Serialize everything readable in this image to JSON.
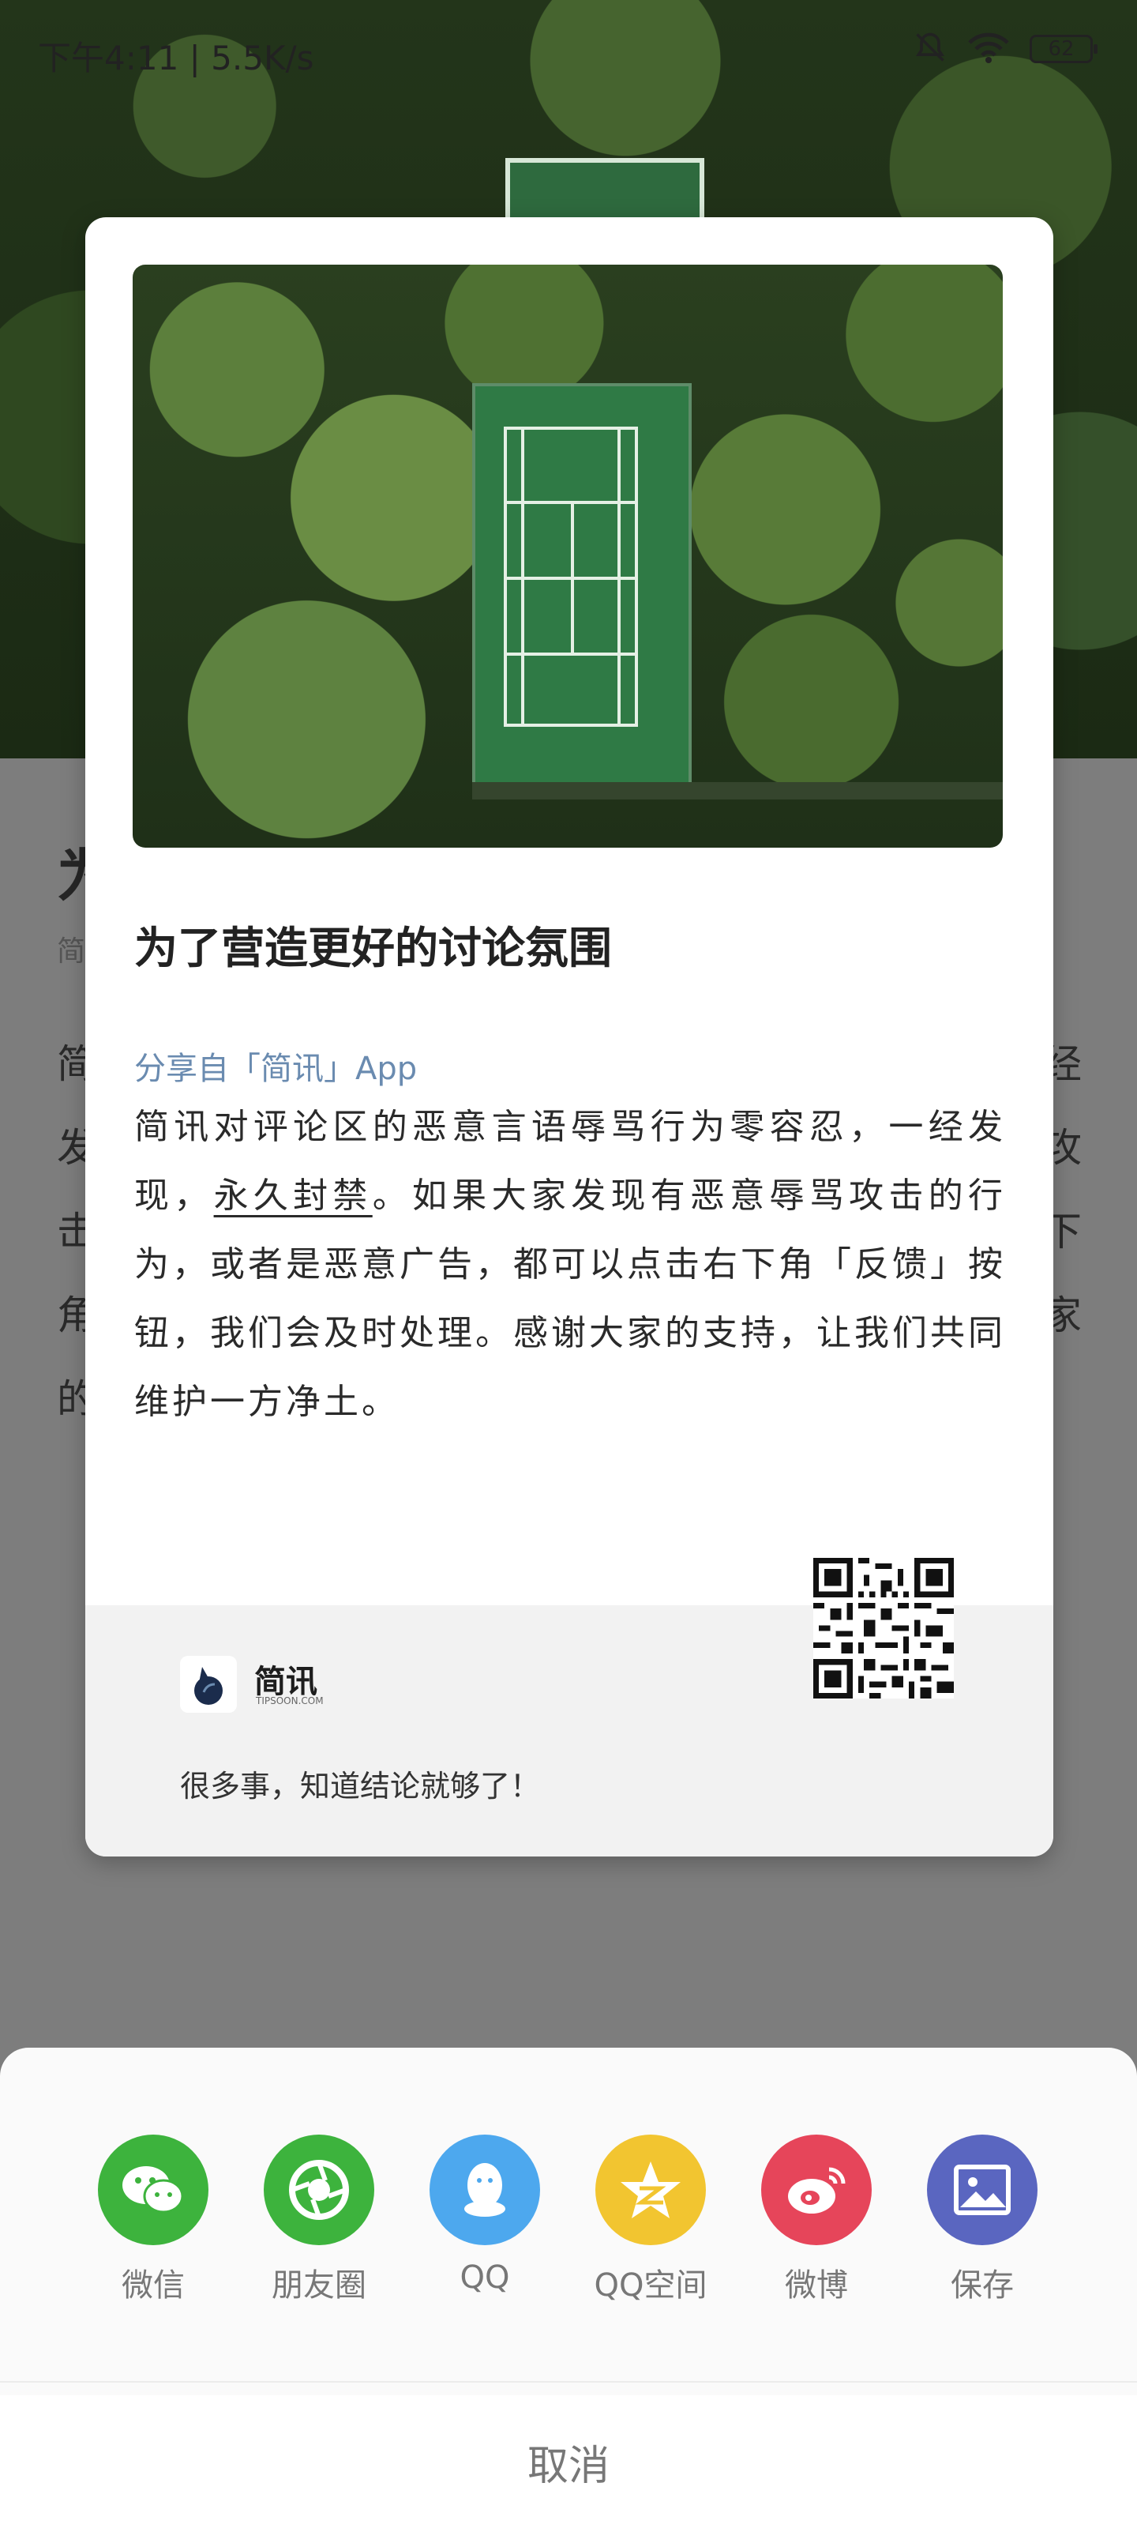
{
  "status_bar": {
    "time": "下午4:11 | 5.5K/s",
    "battery": "62"
  },
  "background": {
    "title_char": "为",
    "meta_char": "简",
    "line_chars_left": [
      "简",
      "发",
      "击",
      "角",
      "的"
    ],
    "line_chars_right": [
      "经",
      "攻",
      "下",
      "家"
    ]
  },
  "card": {
    "title": "为了营造更好的讨论氛围",
    "source": "分享自「简讯」App",
    "text_part1": "简讯对评论区的恶意言语辱骂行为零容忍，一经发现，",
    "text_underlined": "永久封禁",
    "text_part2": "。如果大家发现有恶意辱骂攻击的行为，或者是恶意广告，都可以点击右下角「反馈」按钮，我们会及时处理。感谢大家的支持，让我们共同维护一方净土。",
    "brand_name": "简讯",
    "brand_domain": "TIPSOON.COM",
    "slogan": "很多事，知道结论就够了！"
  },
  "share": {
    "items": [
      {
        "label": "微信",
        "icon": "wechat-icon",
        "color": "#3db33d"
      },
      {
        "label": "朋友圈",
        "icon": "moments-icon",
        "color": "#3db33d"
      },
      {
        "label": "QQ",
        "icon": "qq-icon",
        "color": "#4da8ee"
      },
      {
        "label": "QQ空间",
        "icon": "qzone-icon",
        "color": "#f2c530"
      },
      {
        "label": "微博",
        "icon": "weibo-icon",
        "color": "#e6455a"
      },
      {
        "label": "保存",
        "icon": "save-image-icon",
        "color": "#5a66c0"
      }
    ],
    "cancel": "取消"
  }
}
